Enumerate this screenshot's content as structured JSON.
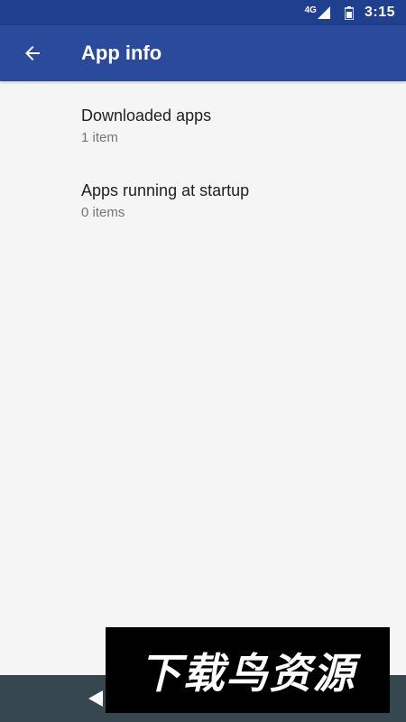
{
  "status_bar": {
    "network": "4G",
    "time": "3:15",
    "signal_icon": "cell-signal-icon",
    "battery_icon": "battery-icon"
  },
  "app_bar": {
    "title": "App info",
    "back_icon": "arrow-back-icon",
    "color": "#2a4a9c"
  },
  "items": [
    {
      "title": "Downloaded apps",
      "subtitle": "1 item"
    },
    {
      "title": "Apps running at startup",
      "subtitle": "0 items"
    }
  ],
  "nav_bar": {
    "back_icon": "nav-back-triangle-icon",
    "color": "#37474f"
  },
  "watermark": {
    "text": "下载鸟资源"
  }
}
